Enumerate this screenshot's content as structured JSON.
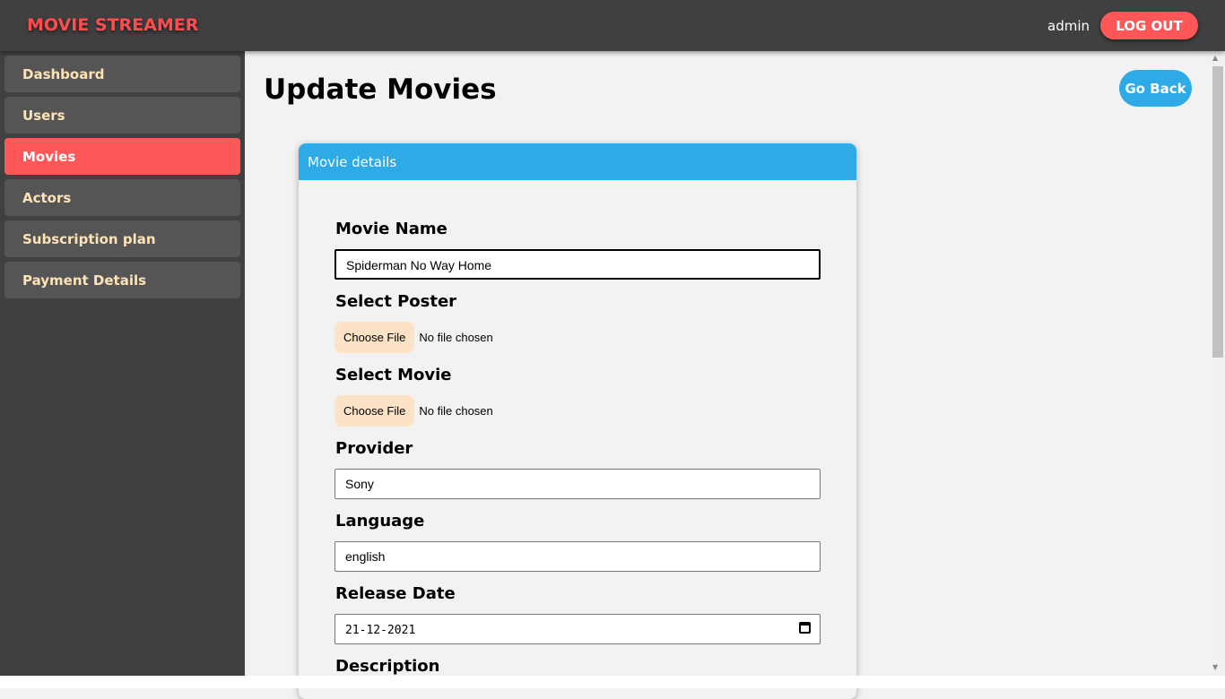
{
  "app": {
    "title": "MOVIE STREAMER",
    "user": "admin",
    "logout": "LOG OUT"
  },
  "sidebar": {
    "items": [
      {
        "label": "Dashboard"
      },
      {
        "label": "Users"
      },
      {
        "label": "Movies",
        "active": true
      },
      {
        "label": "Actors"
      },
      {
        "label": "Subscription plan"
      },
      {
        "label": "Payment Details"
      }
    ]
  },
  "page": {
    "title": "Update Movies",
    "go_back": "Go Back"
  },
  "card": {
    "title": "Movie details",
    "movie_name_label": "Movie Name",
    "movie_name": "Spiderman No Way Home",
    "poster_label": "Select Poster",
    "movie_label": "Select Movie",
    "choose_file": "Choose File",
    "no_file": "No file chosen",
    "provider_label": "Provider",
    "provider": "Sony",
    "language_label": "Language",
    "language": "english",
    "release_label": "Release Date",
    "release_date": "21-12-2021",
    "description_label": "Description"
  },
  "colors": {
    "accent": "#ff5757",
    "blue": "#2eaae6",
    "nav_text": "#fde3b5"
  }
}
